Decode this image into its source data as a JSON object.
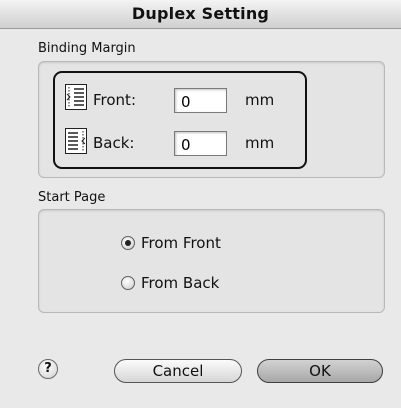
{
  "dialog": {
    "title": "Duplex Setting"
  },
  "binding_margin": {
    "label": "Binding Margin",
    "front": {
      "label": "Front:",
      "value": "0",
      "unit": "mm",
      "icon": "binding-front-icon"
    },
    "back": {
      "label": "Back:",
      "value": "0",
      "unit": "mm",
      "icon": "binding-back-icon"
    }
  },
  "start_page": {
    "label": "Start Page",
    "options": [
      {
        "label": "From Front",
        "selected": true
      },
      {
        "label": "From Back",
        "selected": false
      }
    ]
  },
  "buttons": {
    "help": "?",
    "cancel": "Cancel",
    "ok": "OK"
  }
}
